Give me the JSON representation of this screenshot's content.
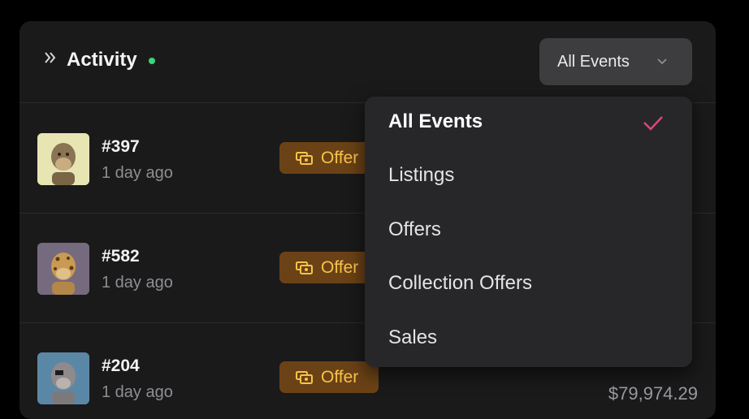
{
  "header": {
    "title": "Activity",
    "filter": {
      "selected": "All Events"
    }
  },
  "dropdown": {
    "options": [
      "All Events",
      "Listings",
      "Offers",
      "Collection Offers",
      "Sales"
    ],
    "selected_index": 0
  },
  "rows": [
    {
      "token": "#397",
      "time": "1 day ago",
      "event": "Offer",
      "price": "",
      "usd": ""
    },
    {
      "token": "#582",
      "time": "1 day ago",
      "event": "Offer",
      "price": "",
      "usd": ""
    },
    {
      "token": "#204",
      "time": "1 day ago",
      "event": "Offer",
      "price": "",
      "usd": "$79,974.29"
    }
  ],
  "colors": {
    "accent_check": "#e0457b",
    "live_dot": "#37d67a",
    "offer_badge_bg": "#6b4216",
    "offer_badge_text": "#f6c44a"
  }
}
